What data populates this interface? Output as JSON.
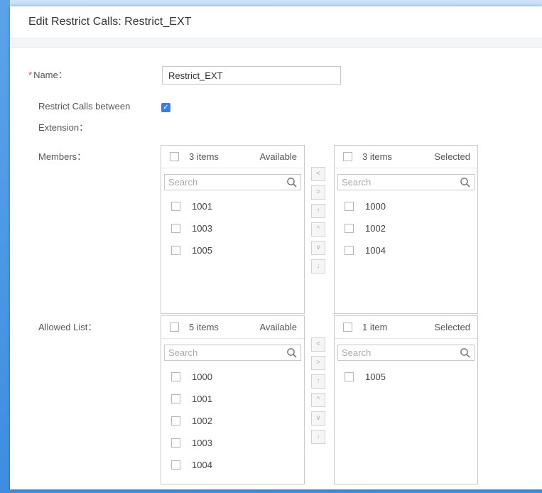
{
  "dialog": {
    "title": "Edit Restrict Calls: Restrict_EXT"
  },
  "form": {
    "name_label": "Name：",
    "name_required_mark": "*",
    "name_value": "Restrict_EXT",
    "restrict_label_line1": "Restrict Calls between",
    "restrict_label_line2": "Extension：",
    "restrict_checked": true,
    "members_label": "Members：",
    "allowed_label": "Allowed List："
  },
  "members": {
    "available": {
      "count": "3 items",
      "title": "Available",
      "search_placeholder": "Search",
      "items": [
        "1001",
        "1003",
        "1005"
      ]
    },
    "selected": {
      "count": "3 items",
      "title": "Selected",
      "search_placeholder": "Search",
      "items": [
        "1000",
        "1002",
        "1004"
      ]
    },
    "ops": [
      "<",
      ">",
      "↑",
      "^",
      "∨",
      "↓"
    ]
  },
  "allowed": {
    "available": {
      "count": "5 items",
      "title": "Available",
      "search_placeholder": "Search",
      "items": [
        "1000",
        "1001",
        "1002",
        "1003",
        "1004"
      ]
    },
    "selected": {
      "count": "1 item",
      "title": "Selected",
      "search_placeholder": "Search",
      "items": [
        "1005"
      ]
    },
    "ops": [
      "<",
      ">",
      "↑",
      "^",
      "∨",
      "↓"
    ]
  },
  "colors": {
    "accent": "#3a7de8",
    "frame": "#3d8ee0",
    "required": "#e54545"
  }
}
